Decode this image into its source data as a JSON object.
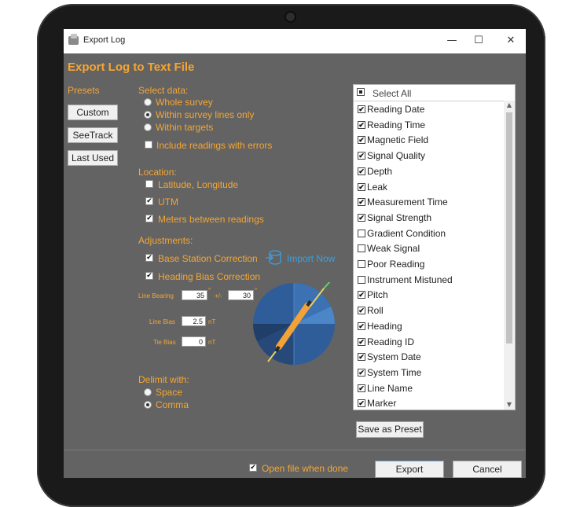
{
  "window": {
    "title": "Export Log",
    "minimize": "—",
    "maximize": "☐",
    "close": "✕"
  },
  "heading": "Export Log to Text File",
  "presets": {
    "label": "Presets",
    "buttons": [
      "Custom",
      "SeeTrack",
      "Last Used"
    ]
  },
  "select_data": {
    "label": "Select data:",
    "options": [
      {
        "label": "Whole survey",
        "selected": false
      },
      {
        "label": "Within survey lines only",
        "selected": true
      },
      {
        "label": "Within targets",
        "selected": false
      }
    ],
    "include_errors": {
      "label": "Include readings with errors",
      "checked": false
    }
  },
  "location": {
    "label": "Location:",
    "options": [
      {
        "label": "Latitude, Longitude",
        "checked": false
      },
      {
        "label": "UTM",
        "checked": true
      },
      {
        "label": "Meters between readings",
        "checked": true
      }
    ]
  },
  "adjustments": {
    "label": "Adjustments:",
    "base_station": {
      "label": "Base Station Correction",
      "checked": true
    },
    "import_now": "Import Now",
    "heading_bias": {
      "label": "Heading Bias Correction",
      "checked": true
    },
    "line_bearing": {
      "label": "Line Bearing",
      "value": "35",
      "pm": "+/-",
      "tolerance": "30",
      "deg": "°"
    },
    "line_bias": {
      "label": "Line Bias",
      "value": "2.5",
      "unit": "nT"
    },
    "tie_bias": {
      "label": "Tie Bias",
      "value": "0",
      "unit": "nT"
    }
  },
  "delimit": {
    "label": "Delimit with:",
    "options": [
      {
        "label": "Space",
        "selected": false
      },
      {
        "label": "Comma",
        "selected": true
      }
    ]
  },
  "fields": {
    "select_all": "Select All",
    "items": [
      {
        "label": "Reading Date",
        "checked": true
      },
      {
        "label": "Reading Time",
        "checked": true
      },
      {
        "label": "Magnetic Field",
        "checked": true
      },
      {
        "label": "Signal Quality",
        "checked": true
      },
      {
        "label": "Depth",
        "checked": true
      },
      {
        "label": "Leak",
        "checked": true
      },
      {
        "label": "Measurement Time",
        "checked": true
      },
      {
        "label": "Signal Strength",
        "checked": true
      },
      {
        "label": "Gradient Condition",
        "checked": false
      },
      {
        "label": "Weak Signal",
        "checked": false
      },
      {
        "label": "Poor Reading",
        "checked": false
      },
      {
        "label": "Instrument Mistuned",
        "checked": false
      },
      {
        "label": "Pitch",
        "checked": true
      },
      {
        "label": "Roll",
        "checked": true
      },
      {
        "label": "Heading",
        "checked": true
      },
      {
        "label": "Reading ID",
        "checked": true
      },
      {
        "label": "System Date",
        "checked": true
      },
      {
        "label": "System Time",
        "checked": true
      },
      {
        "label": "Line Name",
        "checked": true
      },
      {
        "label": "Marker",
        "checked": true
      }
    ]
  },
  "save_preset": "Save as Preset",
  "footer": {
    "open_when_done": {
      "label": "Open file when done",
      "checked": true
    },
    "export": "Export",
    "cancel": "Cancel"
  },
  "colors": {
    "accent": "#f5a633",
    "panel": "#636363",
    "link": "#3aa0e0",
    "dial": "#2f5d9a"
  },
  "icons": {
    "check": "✔",
    "import": "database-import-icon"
  }
}
